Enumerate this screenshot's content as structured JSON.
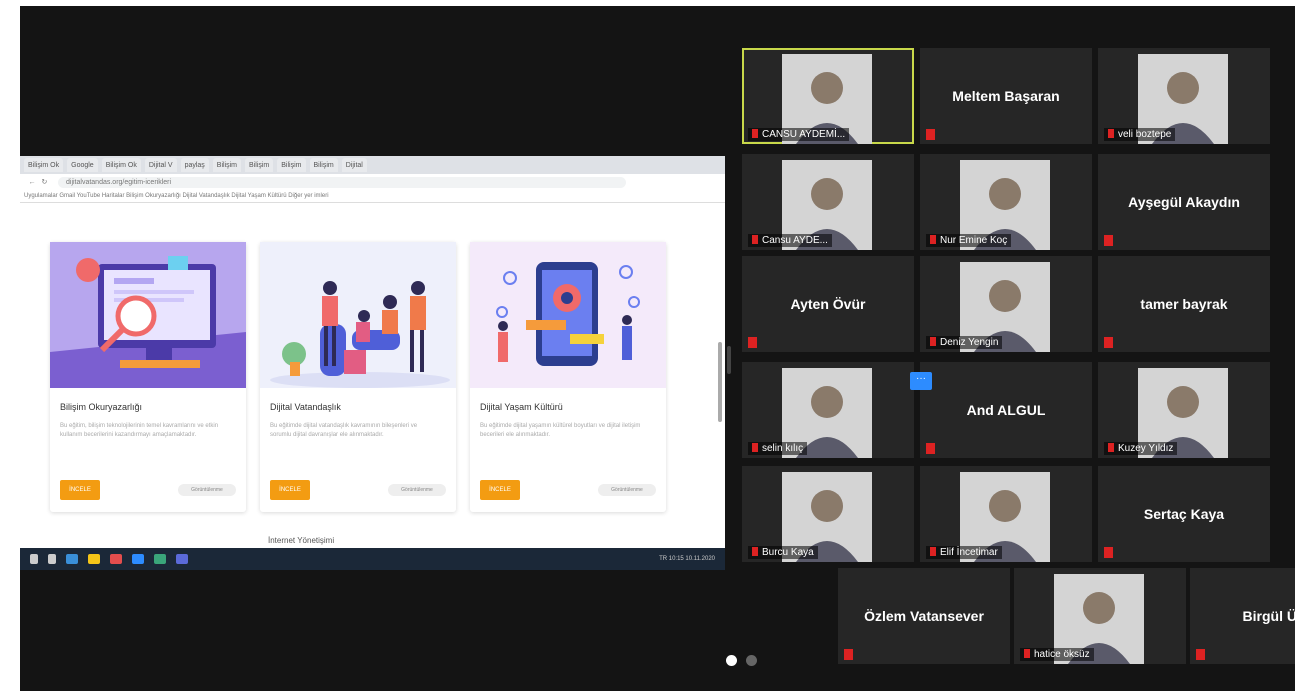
{
  "browser": {
    "tabs": [
      "Bilişim Ok",
      "Google",
      "Bilişim Ok",
      "Dijital V",
      "paylaş",
      "Bilişim",
      "Bilişim",
      "Bilişim",
      "Bilişim",
      "Dijital"
    ],
    "nav": "← ↻",
    "url": "dijitalvatandas.org/egitim-icerikleri",
    "bookmarks": "Uygulamalar   Gmail   YouTube   Haritalar   Bilişim Okuryazarlığı   Dijital Vatandaşlık   Dijital Yaşam Kültürü   Diğer yer imleri"
  },
  "cards": [
    {
      "title": "Bilişim Okuryazarlığı",
      "desc": "Bu eğitim, bilişim teknolojilerinin temel kavramlarını ve etkin kullanım becerilerini kazandırmayı amaçlamaktadır.",
      "button": "İNCELE",
      "views": "Görüntülenme"
    },
    {
      "title": "Dijital Vatandaşlık",
      "desc": "Bu eğitimde dijital vatandaşlık kavramının bileşenleri ve sorumlu dijital davranışlar ele alınmaktadır.",
      "button": "İNCELE",
      "views": "Görüntülenme"
    },
    {
      "title": "Dijital Yaşam Kültürü",
      "desc": "Bu eğitimde dijital yaşamın kültürel boyutları ve dijital iletişim becerileri ele alınmaktadır.",
      "button": "İNCELE",
      "views": "Görüntülenme"
    }
  ],
  "below_card_title": "İnternet Yönetişimi",
  "taskbar": {
    "tray": "TR  10:15  10.11.2020"
  },
  "participants": [
    {
      "name": "CANSU AYDEMİ...",
      "type": "video",
      "active": true
    },
    {
      "name": "Meltem Başaran",
      "type": "name"
    },
    {
      "name": "veli boztepe",
      "type": "video"
    },
    {
      "name": "Cansu AYDE...",
      "type": "video"
    },
    {
      "name": "Nur Emine Koç",
      "type": "video"
    },
    {
      "name": "Ayşegül Akaydın",
      "type": "name"
    },
    {
      "name": "Ayten Övür",
      "type": "name"
    },
    {
      "name": "Deniz Yengin",
      "type": "video"
    },
    {
      "name": "tamer bayrak",
      "type": "name"
    },
    {
      "name": "selin kılıç",
      "type": "video"
    },
    {
      "name": "And ALGUL",
      "type": "name"
    },
    {
      "name": "Kuzey Yıldız",
      "type": "video"
    },
    {
      "name": "Burcu Kaya",
      "type": "video"
    },
    {
      "name": "Elif İncetimar",
      "type": "video"
    },
    {
      "name": "Sertaç Kaya",
      "type": "name"
    },
    {
      "name": "Özlem Vatansever",
      "type": "name"
    },
    {
      "name": "hatice öksüz",
      "type": "video"
    },
    {
      "name": "Birgül Üst",
      "type": "name"
    }
  ],
  "more_button": "···",
  "colors": {
    "active_border": "#c8d84a",
    "mic_muted": "#dd2222",
    "accent_button": "#f39c12",
    "more_button": "#2d8cff"
  }
}
